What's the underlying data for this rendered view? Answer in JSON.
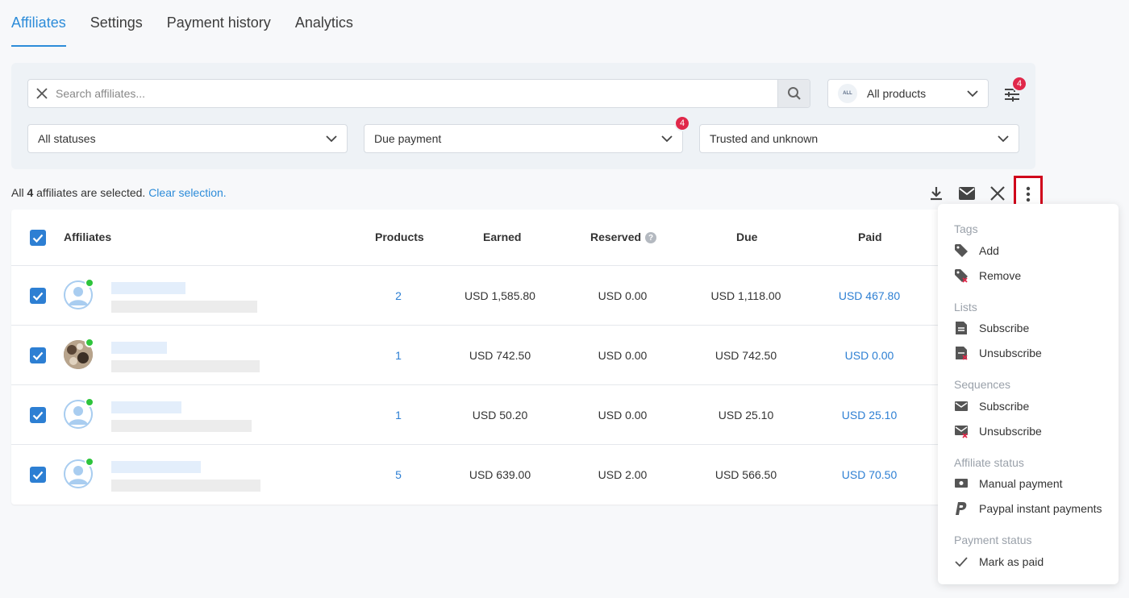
{
  "tabs": [
    {
      "label": "Affiliates",
      "active": true
    },
    {
      "label": "Settings",
      "active": false
    },
    {
      "label": "Payment history",
      "active": false
    },
    {
      "label": "Analytics",
      "active": false
    }
  ],
  "filters": {
    "search_placeholder": "Search affiliates...",
    "products_badge": "ALL",
    "products_label": "All products",
    "filter_count": "4",
    "status_label": "All statuses",
    "due_label": "Due payment",
    "due_count": "4",
    "trust_label": "Trusted and unknown"
  },
  "selection": {
    "prefix": "All",
    "count": "4",
    "suffix": "affiliates are selected.",
    "clear_label": "Clear selection."
  },
  "table": {
    "headers": {
      "affiliates": "Affiliates",
      "products": "Products",
      "earned": "Earned",
      "reserved": "Reserved",
      "due": "Due",
      "paid": "Paid"
    },
    "rows": [
      {
        "products": "2",
        "earned": "USD 1,585.80",
        "reserved": "USD 0.00",
        "due": "USD 1,118.00",
        "paid": "USD 467.80",
        "avatar": "default",
        "online": true
      },
      {
        "products": "1",
        "earned": "USD 742.50",
        "reserved": "USD 0.00",
        "due": "USD 742.50",
        "paid": "USD 0.00",
        "avatar": "photo",
        "online": true
      },
      {
        "products": "1",
        "earned": "USD 50.20",
        "reserved": "USD 0.00",
        "due": "USD 25.10",
        "paid": "USD 25.10",
        "avatar": "default",
        "online": true
      },
      {
        "products": "5",
        "earned": "USD 639.00",
        "reserved": "USD 2.00",
        "due": "USD 566.50",
        "paid": "USD 70.50",
        "avatar": "default",
        "online": true
      }
    ]
  },
  "menu": {
    "tags_title": "Tags",
    "tags_add": "Add",
    "tags_remove": "Remove",
    "lists_title": "Lists",
    "lists_subscribe": "Subscribe",
    "lists_unsubscribe": "Unsubscribe",
    "sequences_title": "Sequences",
    "sequences_subscribe": "Subscribe",
    "sequences_unsubscribe": "Unsubscribe",
    "affiliate_status_title": "Affiliate status",
    "manual_payment": "Manual payment",
    "paypal_instant": "Paypal instant payments",
    "payment_status_title": "Payment status",
    "mark_as_paid": "Mark as paid"
  },
  "colors": {
    "accent": "#2d8cd9",
    "badge": "#e0284a",
    "online": "#2ec43c",
    "highlight": "#d0021b"
  }
}
